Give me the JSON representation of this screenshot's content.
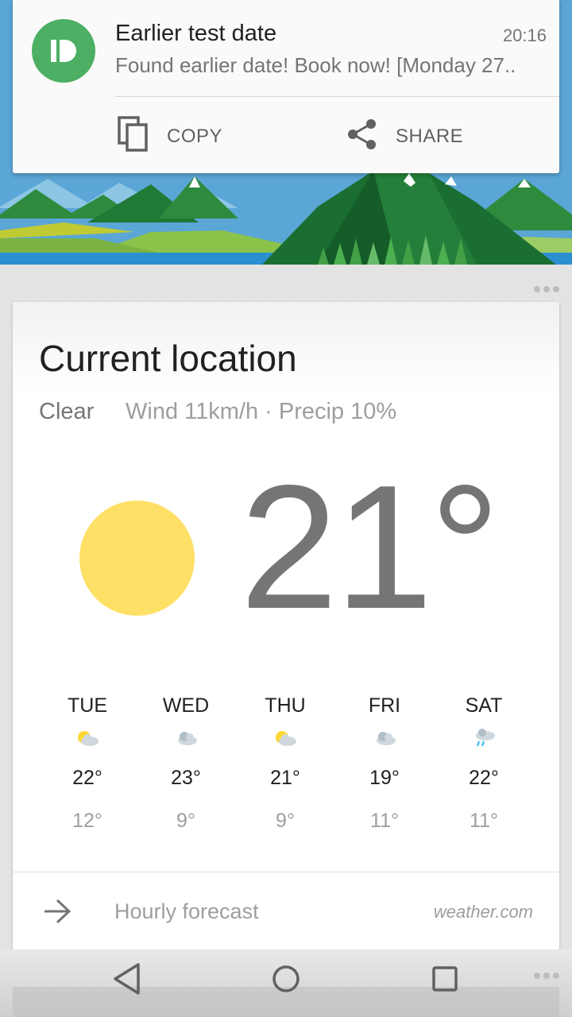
{
  "notification": {
    "app_icon": "pushbullet-icon",
    "title": "Earlier test date",
    "time": "20:16",
    "text": "Found earlier date! Book now! [Monday 27..",
    "actions": [
      {
        "label": "COPY",
        "icon": "copy-icon"
      },
      {
        "label": "SHARE",
        "icon": "share-icon"
      }
    ]
  },
  "weather": {
    "location": "Current location",
    "condition": "Clear",
    "details": "Wind 11km/h · Precip 10%",
    "temperature": "21°",
    "condition_icon": "sun-icon",
    "forecast": [
      {
        "day": "TUE",
        "icon": "partly-sunny-icon",
        "high": "22°",
        "low": "12°"
      },
      {
        "day": "WED",
        "icon": "cloudy-icon",
        "high": "23°",
        "low": "9°"
      },
      {
        "day": "THU",
        "icon": "partly-sunny-icon",
        "high": "21°",
        "low": "9°"
      },
      {
        "day": "FRI",
        "icon": "cloudy-icon",
        "high": "19°",
        "low": "11°"
      },
      {
        "day": "SAT",
        "icon": "rain-icon",
        "high": "22°",
        "low": "11°"
      }
    ],
    "hourly_label": "Hourly forecast",
    "source": "weather.com"
  },
  "navbar": {
    "back": "back-icon",
    "home": "home-icon",
    "recents": "recents-icon"
  },
  "colors": {
    "avatar": "#4caf63",
    "sun": "#ffe066",
    "rain": "#4fc3f7"
  }
}
